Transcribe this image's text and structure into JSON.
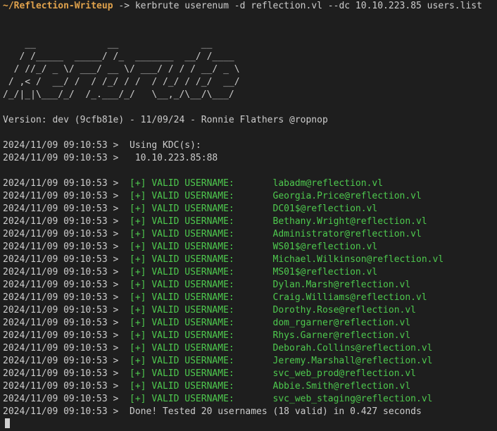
{
  "prompt": {
    "path": "~/Reflection-Writeup",
    "arrow": " -> ",
    "command": "kerbrute userenum -d reflection.vl --dc 10.10.223.85 users.list"
  },
  "banner": [
    "    __             __               __     ",
    "   / /_____  _____/ /_  _______  __/ /____ ",
    "  / //_/ _ \\/ ___/ __ \\/ ___/ / / / __/ _ \\",
    " / ,< /  __/ /  / /_/ / /  / /_/ / /_/  __/",
    "/_/|_|\\___/_/  /_.___/_/   \\__,_/\\__/\\___/ "
  ],
  "version_line": "Version: dev (9cfb81e) - 11/09/24 - Ronnie Flathers @ropnop",
  "kdc": {
    "ts": "2024/11/09 09:10:53 >  ",
    "label": "Using KDC(s):",
    "value": " 10.10.223.85:88"
  },
  "results": {
    "ts": "2024/11/09 09:10:53 >  ",
    "tag": "[+] VALID USERNAME:\t ",
    "users": [
      "labadm@reflection.vl",
      "Georgia.Price@reflection.vl",
      "DC01$@reflection.vl",
      "Bethany.Wright@reflection.vl",
      "Administrator@reflection.vl",
      "WS01$@reflection.vl",
      "Michael.Wilkinson@reflection.vl",
      "MS01$@reflection.vl",
      "Dylan.Marsh@reflection.vl",
      "Craig.Williams@reflection.vl",
      "Dorothy.Rose@reflection.vl",
      "dom_rgarner@reflection.vl",
      "Rhys.Garner@reflection.vl",
      "Deborah.Collins@reflection.vl",
      "Jeremy.Marshall@reflection.vl",
      "svc_web_prod@reflection.vl",
      "Abbie.Smith@reflection.vl",
      "svc_web_staging@reflection.vl"
    ]
  },
  "done": {
    "ts": "2024/11/09 09:10:53 >  ",
    "text": "Done! Tested 20 usernames (18 valid) in 0.427 seconds"
  }
}
